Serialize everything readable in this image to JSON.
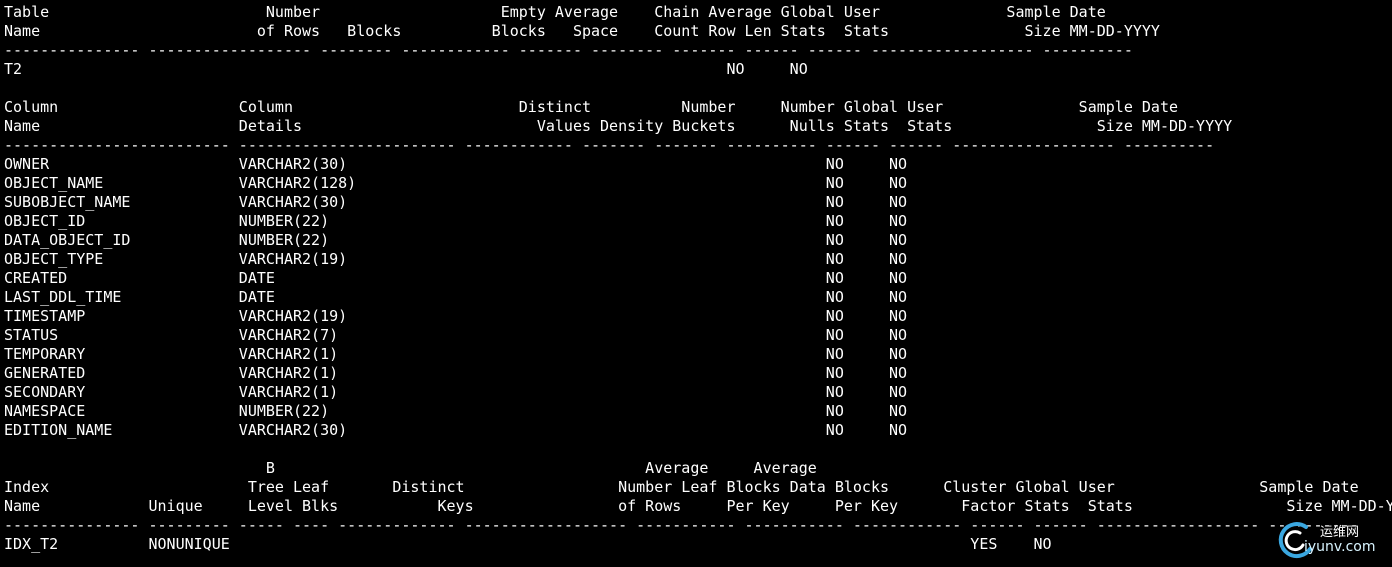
{
  "terminal": {
    "lines": [
      "Table                        Number                    Empty Average    Chain Average Global User              Sample Date",
      "Name                        of Rows   Blocks          Blocks   Space    Count Row Len Stats  Stats               Size MM-DD-YYYY",
      "--------------- ------------------ -------- ------------ ------- -------- ------- ------ ------ ------------------ ----------",
      "T2                                                                              NO     NO",
      "",
      "Column                    Column                         Distinct          Number     Number Global User               Sample Date",
      "Name                      Details                          Values Density Buckets      Nulls Stats  Stats                Size MM-DD-YYYY",
      "------------------------- ------------------------ ------------ ------- ------- ---------- ------ ------ ------------------ ----------",
      "OWNER                     VARCHAR2(30)                                                     NO     NO",
      "OBJECT_NAME               VARCHAR2(128)                                                    NO     NO",
      "SUBOBJECT_NAME            VARCHAR2(30)                                                     NO     NO",
      "OBJECT_ID                 NUMBER(22)                                                       NO     NO",
      "DATA_OBJECT_ID            NUMBER(22)                                                       NO     NO",
      "OBJECT_TYPE               VARCHAR2(19)                                                     NO     NO",
      "CREATED                   DATE                                                             NO     NO",
      "LAST_DDL_TIME             DATE                                                             NO     NO",
      "TIMESTAMP                 VARCHAR2(19)                                                     NO     NO",
      "STATUS                    VARCHAR2(7)                                                      NO     NO",
      "TEMPORARY                 VARCHAR2(1)                                                      NO     NO",
      "GENERATED                 VARCHAR2(1)                                                      NO     NO",
      "SECONDARY                 VARCHAR2(1)                                                      NO     NO",
      "NAMESPACE                 NUMBER(22)                                                       NO     NO",
      "EDITION_NAME              VARCHAR2(30)                                                     NO     NO",
      "",
      "                             B                                         Average     Average",
      "Index                      Tree Leaf       Distinct                 Number Leaf Blocks Data Blocks      Cluster Global User                Sample Date",
      "Name            Unique     Level Blks           Keys                of Rows     Per Key     Per Key       Factor Stats  Stats                 Size MM-DD-YYYY",
      "--------------- --------- ----- ---- ------------- ------------------ ----------- ----------- ------------ ------ ------ ------------------ ----------",
      "IDX_T2          NONUNIQUE                                                                                  YES    NO"
    ]
  },
  "watermark": {
    "cn": "运维网",
    "en": "iyunv.com"
  },
  "colors": {
    "background": "#000000",
    "text": "#ffffff",
    "watermark_accent": "#3aa7e0"
  }
}
